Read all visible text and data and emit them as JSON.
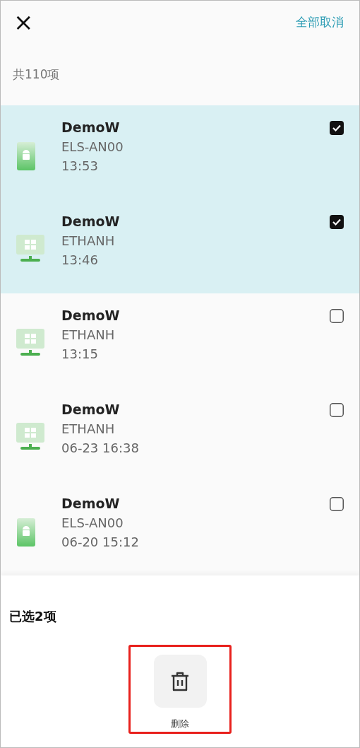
{
  "header": {
    "close": "×",
    "action": "全部取消"
  },
  "count": "共110项",
  "devices": [
    {
      "kind": "android",
      "name": "DemoW",
      "model": "ELS-AN00",
      "time": "13:53",
      "selected": true
    },
    {
      "kind": "windows",
      "name": "DemoW",
      "model": "ETHANH",
      "time": "13:46",
      "selected": true
    },
    {
      "kind": "windows",
      "name": "DemoW",
      "model": "ETHANH",
      "time": "13:15",
      "selected": false
    },
    {
      "kind": "windows",
      "name": "DemoW",
      "model": "ETHANH",
      "time": "06-23 16:38",
      "selected": false
    },
    {
      "kind": "android",
      "name": "DemoW",
      "model": "ELS-AN00",
      "time": "06-20 15:12",
      "selected": false
    }
  ],
  "footer": {
    "selected_count": "已选2项",
    "actions": [
      {
        "label": "删除",
        "highlighted": true
      }
    ]
  }
}
